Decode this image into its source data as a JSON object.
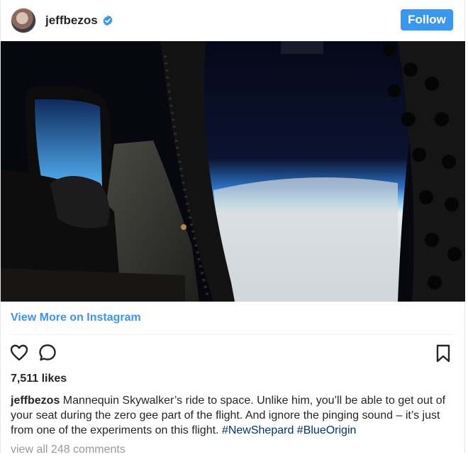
{
  "post": {
    "username": "jeffbezos",
    "verified": true,
    "follow_label": "Follow",
    "view_more_label": "View More on Instagram",
    "likes_text": "7,511 likes",
    "caption_user": "jeffbezos",
    "caption_text": " Mannequin Skywalker’s ride to space. Unlike him, you’ll be able to get out of your seat during the zero gee part of the flight. And ignore the pinging sound – it’s just from one of the experiments on this flight. ",
    "hashtags": [
      "#NewShepard",
      "#BlueOrigin"
    ],
    "view_comments_label": "view all 248 comments"
  },
  "colors": {
    "accent": "#3897f0",
    "hashtag": "#003569",
    "muted": "#999999",
    "text": "#262626"
  },
  "icons": {
    "verified": "verified-badge-icon",
    "like": "heart-icon",
    "comment": "comment-bubble-icon",
    "save": "bookmark-icon"
  }
}
